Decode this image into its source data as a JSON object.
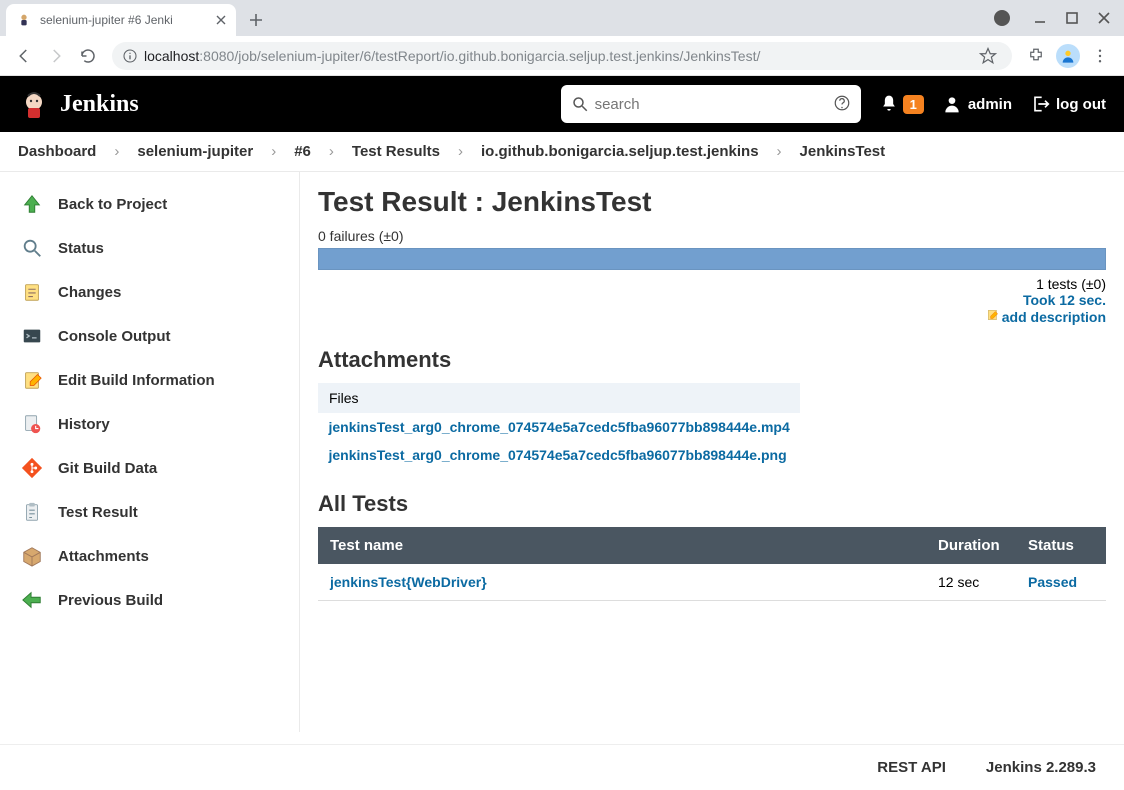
{
  "browser": {
    "tab_title": "selenium-jupiter #6 Jenki",
    "url_host": "localhost",
    "url_port": ":8080",
    "url_path": "/job/selenium-jupiter/6/testReport/io.github.bonigarcia.seljup.test.jenkins/JenkinsTest/"
  },
  "header": {
    "brand": "Jenkins",
    "search_placeholder": "search",
    "notifications": "1",
    "user": "admin",
    "logout": "log out"
  },
  "breadcrumb": [
    "Dashboard",
    "selenium-jupiter",
    "#6",
    "Test Results",
    "io.github.bonigarcia.seljup.test.jenkins",
    "JenkinsTest"
  ],
  "sidebar": {
    "items": [
      {
        "label": "Back to Project"
      },
      {
        "label": "Status"
      },
      {
        "label": "Changes"
      },
      {
        "label": "Console Output"
      },
      {
        "label": "Edit Build Information"
      },
      {
        "label": "History"
      },
      {
        "label": "Git Build Data"
      },
      {
        "label": "Test Result"
      },
      {
        "label": "Attachments"
      },
      {
        "label": "Previous Build"
      }
    ]
  },
  "main": {
    "title": "Test Result : JenkinsTest",
    "failures": "0 failures (±0)",
    "tests_count": "1 tests (±0)",
    "took": "Took 12 sec.",
    "add_description": "add description",
    "attachments_heading": "Attachments",
    "attachments_col": "Files",
    "attachments": [
      "jenkinsTest_arg0_chrome_074574e5a7cedc5fba96077bb898444e.mp4",
      "jenkinsTest_arg0_chrome_074574e5a7cedc5fba96077bb898444e.png"
    ],
    "all_tests_heading": "All Tests",
    "columns": {
      "name": "Test name",
      "duration": "Duration",
      "status": "Status"
    },
    "rows": [
      {
        "name": "jenkinsTest{WebDriver}",
        "duration": "12 sec",
        "status": "Passed"
      }
    ]
  },
  "footer": {
    "rest_api": "REST API",
    "version": "Jenkins 2.289.3"
  }
}
